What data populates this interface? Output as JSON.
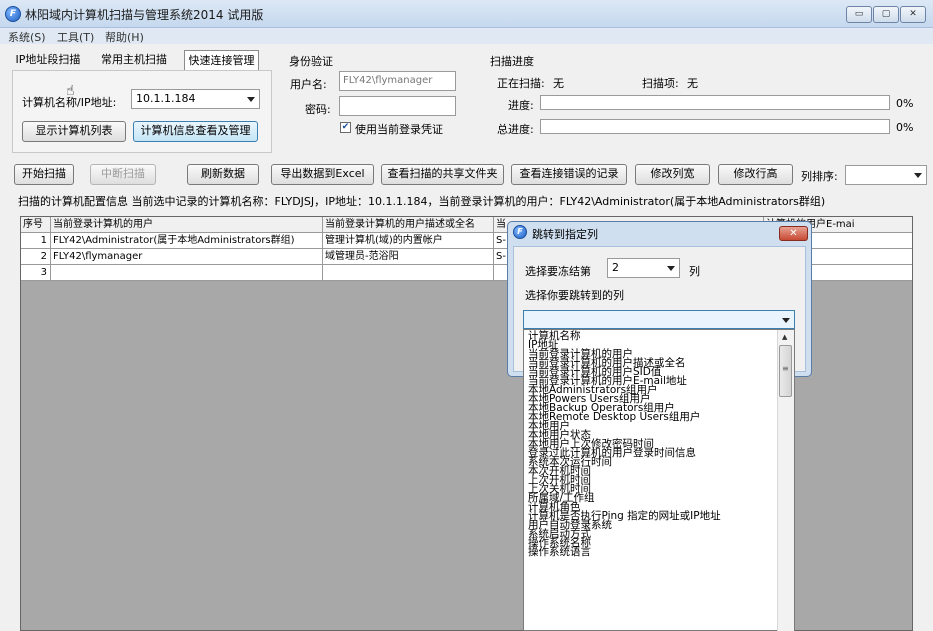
{
  "window": {
    "title": "林阳域内计算机扫描与管理系统2014 试用版",
    "icon_text": "F",
    "controls": {
      "minimize": "▭",
      "maximize": "▢",
      "close": "✕"
    }
  },
  "menubar": [
    "系统(S)",
    "工具(T)",
    "帮助(H)"
  ],
  "tabs": [
    "IP地址段扫描",
    "常用主机扫描",
    "快速连接管理"
  ],
  "quick": {
    "computer_label": "计算机名称/IP地址:",
    "computer_value": "10.1.1.184",
    "show_list_button": "显示计算机列表",
    "view_info_button": "计算机信息查看及管理"
  },
  "auth": {
    "title": "身份验证",
    "user_label": "用户名:",
    "user_value": "FLY42\\flymanager",
    "password_label": "密码:",
    "password_value": "",
    "use_current_label": "使用当前登录凭证",
    "use_current_checked": true
  },
  "progress": {
    "title": "扫描进度",
    "scanning_label": "正在扫描:",
    "scanning_value": "无",
    "item_label": "扫描项:",
    "item_value": "无",
    "progress_label": "进度:",
    "progress_value": "0%",
    "progress_fraction": 0,
    "total_label": "总进度:",
    "total_value": "0%",
    "total_fraction": 0
  },
  "toolbar": {
    "start": "开始扫描",
    "stop": "中断扫描",
    "refresh": "刷新数据",
    "export": "导出数据到Excel",
    "view_shares": "查看扫描的共享文件夹",
    "view_errors": "查看连接错误的记录",
    "change_width": "修改列宽",
    "change_height": "修改行高",
    "sort_label": "列排序:",
    "sort_value": ""
  },
  "info_text": "扫描的计算机配置信息  当前选中记录的计算机名称：FLYDJSJ，IP地址：10.1.1.184，当前登录计算机的用户：FLY42\\Administrator(属于本地Administrators群组)",
  "grid": {
    "headers": [
      "序号",
      "当前登录计算机的用户",
      "当前登录计算机的用户描述或全名",
      "当",
      "",
      "计算机的用户E-mai"
    ],
    "rows": [
      [
        "1",
        "FLY42\\Administrator(属于本地Administrators群组)",
        "管理计算机(域)的内置帐户",
        "S-"
      ],
      [
        "2",
        "FLY42\\flymanager",
        "域管理员-范浴阳",
        "S-"
      ],
      [
        "3",
        "",
        "",
        ""
      ]
    ]
  },
  "dialog": {
    "title": "跳转到指定列",
    "freeze_label": "选择要冻结第",
    "freeze_value": "2",
    "freeze_suffix": "列",
    "column_label": "选择你要跳转到的列",
    "column_value": "",
    "close": "✕"
  },
  "column_options": [
    "计算机名称",
    "IP地址",
    "当前登录计算机的用户",
    "当前登录计算机的用户描述或全名",
    "当前登录计算机的用户SID值",
    "当前登录计算机的用户E-mail地址",
    "本地Administrators组用户",
    "本地Powers Users组用户",
    "本地Backup Operators组用户",
    "本地Remote Desktop Users组用户",
    "本地用户",
    "本地用户状态",
    "本地用户上次修改密码时间",
    "登录过此计算机的用户登录时间信息",
    "系统本次运行时间",
    "本次开机时间",
    "上次开机时间",
    "上次关机时间",
    "所属域/工作组",
    "计算机角色",
    "计算机是否执行Ping 指定的网址或IP地址",
    "用户自动登录系统",
    "系统启动方式",
    "操作系统名称",
    "操作系统语言"
  ],
  "colors": {
    "title_bar": "#c5d8ee",
    "highlight_button": "#c4e5f6",
    "grid_background": "#a8a8a8",
    "dialog_frame": "#cfdff0",
    "close_button": "#c74a33"
  }
}
